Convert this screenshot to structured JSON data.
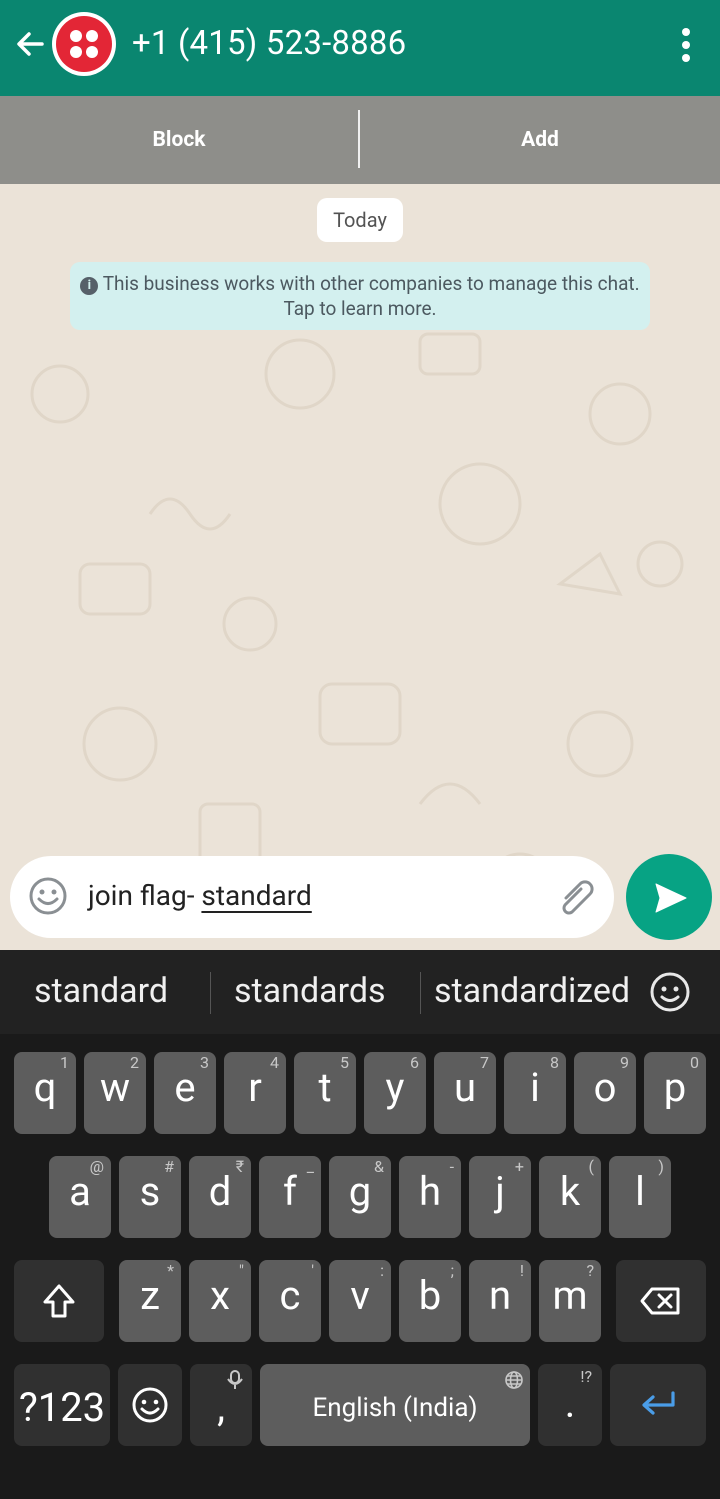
{
  "header": {
    "title": "+1 (415) 523-8886"
  },
  "actions": {
    "block": "Block",
    "add": "Add"
  },
  "chat": {
    "date_chip": "Today",
    "notice": "This business works with other companies to manage this chat. Tap to learn more.",
    "notice_icon": "i"
  },
  "composer": {
    "text_prefix": "join flag- ",
    "text_underlined": "standard"
  },
  "suggestions": [
    "standard",
    "standards",
    "standardized"
  ],
  "keyboard": {
    "row1": [
      {
        "ch": "q",
        "sub": "1"
      },
      {
        "ch": "w",
        "sub": "2"
      },
      {
        "ch": "e",
        "sub": "3"
      },
      {
        "ch": "r",
        "sub": "4"
      },
      {
        "ch": "t",
        "sub": "5"
      },
      {
        "ch": "y",
        "sub": "6"
      },
      {
        "ch": "u",
        "sub": "7"
      },
      {
        "ch": "i",
        "sub": "8"
      },
      {
        "ch": "o",
        "sub": "9"
      },
      {
        "ch": "p",
        "sub": "0"
      }
    ],
    "row2": [
      {
        "ch": "a",
        "sub": "@"
      },
      {
        "ch": "s",
        "sub": "#"
      },
      {
        "ch": "d",
        "sub": "₹"
      },
      {
        "ch": "f",
        "sub": "_"
      },
      {
        "ch": "g",
        "sub": "&"
      },
      {
        "ch": "h",
        "sub": "-"
      },
      {
        "ch": "j",
        "sub": "+"
      },
      {
        "ch": "k",
        "sub": "("
      },
      {
        "ch": "l",
        "sub": ")"
      }
    ],
    "row3": [
      {
        "ch": "z",
        "sub": "*"
      },
      {
        "ch": "x",
        "sub": "\""
      },
      {
        "ch": "c",
        "sub": "'"
      },
      {
        "ch": "v",
        "sub": ":"
      },
      {
        "ch": "b",
        "sub": ";"
      },
      {
        "ch": "n",
        "sub": "!"
      },
      {
        "ch": "m",
        "sub": "?"
      }
    ],
    "sym_label": "?123",
    "comma": ",",
    "space_label": "English (India)",
    "period": ".",
    "period_sub": "!?"
  },
  "colors": {
    "header": "#0a8670",
    "send": "#07a384",
    "enter": "#4a9de8"
  }
}
